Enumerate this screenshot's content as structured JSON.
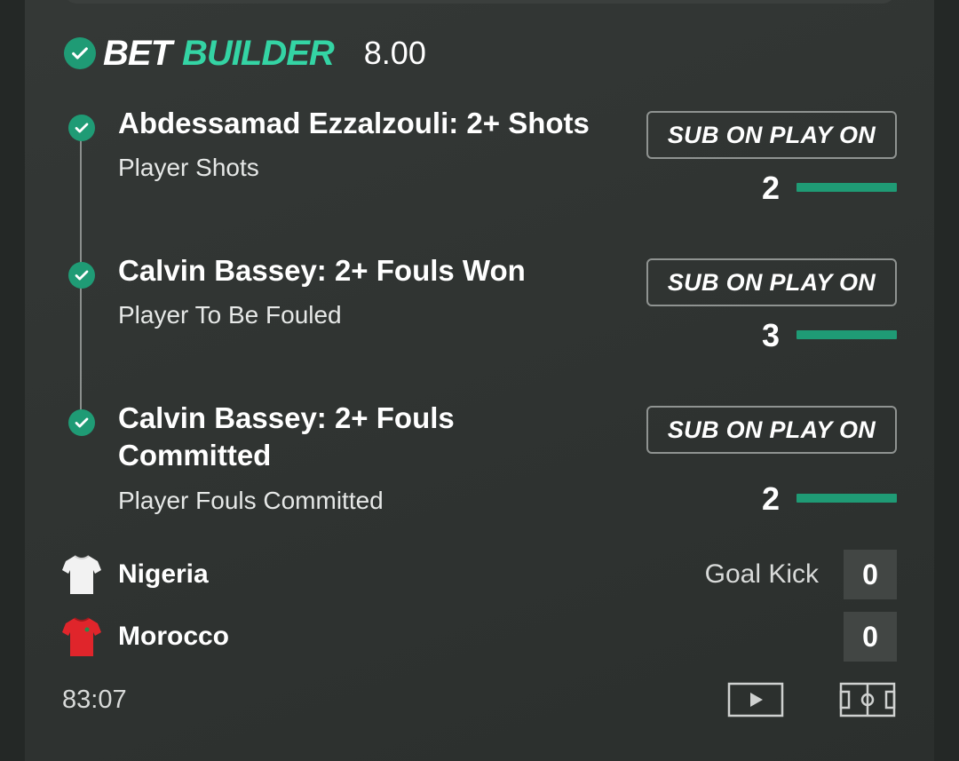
{
  "bet_builder": {
    "brand_part1": "BET",
    "brand_part2": "BUILDER",
    "odds": "8.00"
  },
  "legs": [
    {
      "title": "Abdessamad Ezzalzouli: 2+ Shots",
      "market": "Player Shots",
      "button": "SUB ON PLAY ON",
      "current": "2",
      "target": 2
    },
    {
      "title": "Calvin Bassey: 2+ Fouls Won",
      "market": "Player To Be Fouled",
      "button": "SUB ON PLAY ON",
      "current": "3",
      "target": 2
    },
    {
      "title": "Calvin Bassey: 2+ Fouls Committed",
      "market": "Player Fouls Committed",
      "button": "SUB ON PLAY ON",
      "current": "2",
      "target": 2
    }
  ],
  "match": {
    "home": {
      "name": "Nigeria",
      "score": "0",
      "shirt_color": "#f2f2f2"
    },
    "away": {
      "name": "Morocco",
      "score": "0",
      "shirt_color": "#e0252b"
    },
    "last_event": "Goal Kick",
    "clock": "83:07"
  },
  "colors": {
    "accent": "#34d4a4",
    "progress": "#1f9b75",
    "background": "#2f3331"
  },
  "icons": [
    "check-icon",
    "play-video-icon",
    "pitch-tracker-icon",
    "shirt-icon"
  ]
}
